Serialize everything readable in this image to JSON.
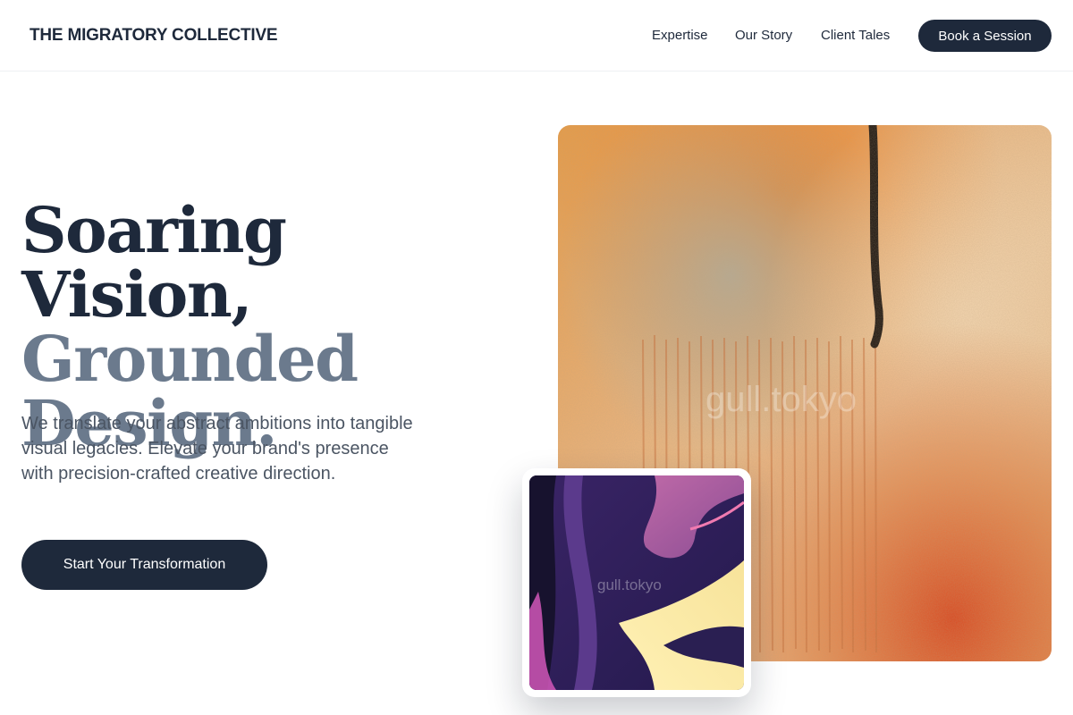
{
  "brand": "THE MIGRATORY COLLECTIVE",
  "nav": {
    "links": [
      "Expertise",
      "Our Story",
      "Client Tales"
    ],
    "cta": "Book a Session"
  },
  "hero": {
    "title_line1": "Soaring Vision,",
    "title_line2": "Grounded",
    "title_line3": "Design.",
    "subtitle": "We translate your abstract ambitions into tangible visual legacies. Elevate your brand's presence with precision-crafted creative direction.",
    "cta": "Start Your Transformation"
  },
  "images": {
    "main_watermark": "gull.tokyo",
    "small_watermark": "gull.tokyo"
  },
  "colors": {
    "primary": "#1e293b",
    "muted_heading": "#6b7a8d",
    "body_text": "#4b5563"
  }
}
